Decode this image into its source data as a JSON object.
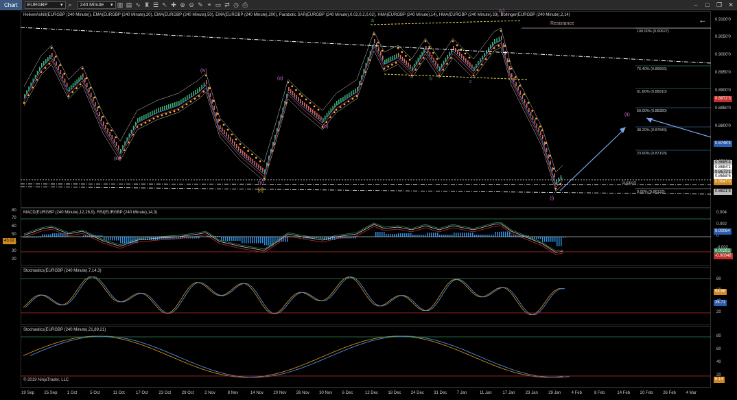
{
  "toolbar": {
    "chart_tab": "Chart",
    "instrument": "EURGBP",
    "timeframe": "240 Minute"
  },
  "main_pane": {
    "title": "HeikenAshi8(EURGBP (240 Minute)), EMA(EURGBP (240 Minute),20), EMA(EURGBP (240 Minute),50), EMA(EURGBP (240 Minute),200), Parabolic SAR(EURGBP (240 Minute),0.02,0.2,0.02), HMA(EURGBP (240 Minute),14), HMA(EURGBP (240 Minute),33), Bollinger(EURGBP (240 Minute),2,14)",
    "resistance": "Resistance",
    "support": "Support",
    "price_axis": [
      "0.9100'0",
      "0.9050'0",
      "0.9000'0",
      "0.8950'0",
      "0.8900'0",
      "0.8850'0",
      "0.8800'0",
      "0.8750'0",
      "0.8700'0",
      "0.8650'0"
    ],
    "price_tags": [
      {
        "text": "0.8872'3",
        "color": "#c0302a"
      },
      {
        "text": "0.8748'4",
        "color": "#2a5fb0"
      },
      {
        "text": "0.8685'4",
        "color": "#bbbbbb"
      },
      {
        "text": "0.8684'1",
        "color": "#ffffff"
      },
      {
        "text": "0.8673'1",
        "color": "#bbbbbb"
      },
      {
        "text": "0.8658'6",
        "color": "#ffffff"
      },
      {
        "text": "0.8647'0",
        "color": "#d08a20"
      },
      {
        "text": "0.8621'8",
        "color": "#bbbbbb"
      }
    ],
    "fib_levels": [
      {
        "label": "100.00% (0.90627)",
        "color": "#cccccc"
      },
      {
        "label": "76.40% (0.89566)",
        "color": "#3cb371"
      },
      {
        "label": "61.80% (0.88910)",
        "color": "#20b2aa"
      },
      {
        "label": "50.00% (0.88380)",
        "color": "#4f8fd8"
      },
      {
        "label": "38.20% (0.87849)",
        "color": "#4f8fd8"
      },
      {
        "label": "23.60% (0.87193)",
        "color": "#4f8fd8"
      },
      {
        "label": "0.00% (0.86133)",
        "color": "#cccccc"
      }
    ],
    "wave_labels": [
      "(iii)",
      "(iv)",
      "(v)",
      "[d]",
      "(a)",
      "(b)",
      "(c)",
      "(ii)",
      "(i)",
      "a",
      "b",
      "c"
    ]
  },
  "macd_pane": {
    "title": "MACD(EURGBP (240 Minute),12,26,9), RSI(EURGBP (240 Minute),14,3)",
    "left_axis": [
      "80",
      "70",
      "60",
      "50",
      "40",
      "30",
      "20"
    ],
    "right_axis": [
      "0.004",
      "0.002",
      "0",
      "-0.002"
    ],
    "rsi_tag": "43.02",
    "tags": [
      {
        "text": "0.00084",
        "color": "#2a5fb0"
      },
      {
        "text": "0.00263",
        "color": "#2e8b57"
      },
      {
        "text": "-0.00348",
        "color": "#c0302a"
      }
    ]
  },
  "stoch1_pane": {
    "title": "Stochastics(EURGBP (240 Minute),7,14,3)",
    "axis": [
      "80",
      "60",
      "40",
      "20"
    ],
    "tags": [
      {
        "text": "58.68",
        "color": "#d08a20"
      },
      {
        "text": "36.71",
        "color": "#2a5fb0"
      }
    ]
  },
  "stoch2_pane": {
    "title": "Stochastics(EURGBP (240 Minute),21,89,21)",
    "axis": [
      "80",
      "60",
      "40",
      "20"
    ],
    "copyright": "© 2019 NinjaTrader, LLC",
    "tags": [
      {
        "text": "6.14",
        "color": "#d08a20"
      }
    ]
  },
  "date_axis": [
    "19 Sep",
    "25 Sep",
    "1 Oct",
    "5 Oct",
    "11 Oct",
    "17 Oct",
    "23 Oct",
    "29 Oct",
    "2 Nov",
    "8 Nov",
    "14 Nov",
    "20 Nov",
    "26 Nov",
    "30 Nov",
    "6 Dec",
    "12 Dec",
    "18 Dec",
    "24 Dec",
    "31 Dec",
    "7 Jan",
    "11 Jan",
    "17 Jan",
    "23 Jan",
    "29 Jan",
    "4 Feb",
    "8 Feb",
    "14 Feb",
    "20 Feb",
    "26 Feb",
    "4 Mar"
  ],
  "colors": {
    "up_candle": "#3cb371",
    "down_candle": "#e06666",
    "sar": "#f0b030",
    "fib_arrow": "#7aa7e8",
    "macd_hist": "#2a8fe8"
  }
}
